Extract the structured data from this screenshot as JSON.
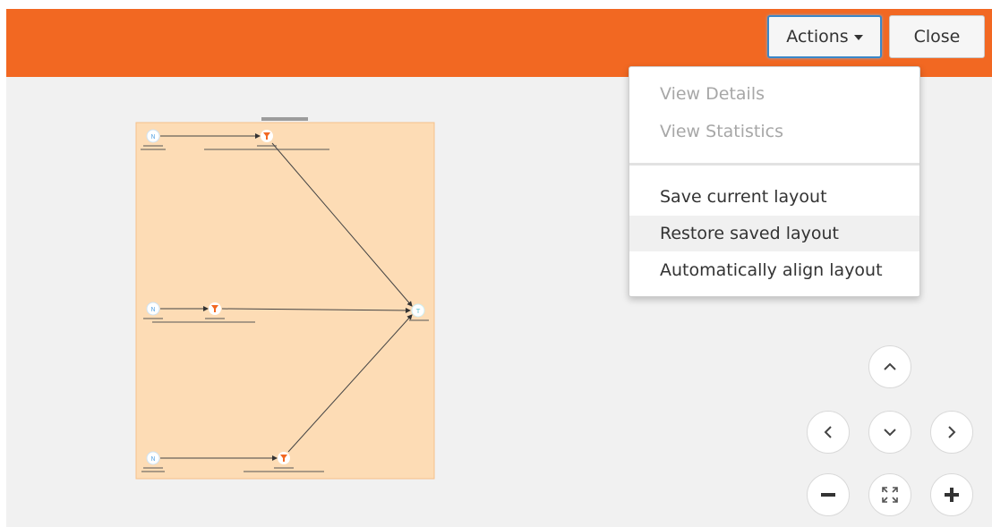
{
  "toolbar": {
    "actions_label": "Actions",
    "close_label": "Close"
  },
  "menu": {
    "items": [
      {
        "label": "View Details",
        "disabled": true
      },
      {
        "label": "View Statistics",
        "disabled": true
      },
      {
        "label": "Save current layout",
        "disabled": false
      },
      {
        "label": "Restore saved layout",
        "disabled": false,
        "hovered": true
      },
      {
        "label": "Automatically align layout",
        "disabled": false
      }
    ]
  },
  "controls": [
    "pan-up",
    "pan-left",
    "pan-down",
    "pan-right",
    "zoom-out",
    "fit-screen",
    "zoom-in"
  ],
  "colors": {
    "header": "#f26822",
    "canvas": "#f1f1f1",
    "diagram_bg": "#fddcb5",
    "node_icon": "#f26822",
    "source_icon": "#6aaee6",
    "target_icon": "#5cc2cf"
  }
}
